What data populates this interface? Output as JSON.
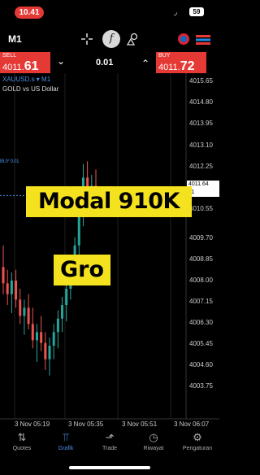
{
  "status_bar": {
    "time": "10.41",
    "battery": "59",
    "colors": {
      "time_pill": "#e53935"
    }
  },
  "toolbar": {
    "timeframe": "M1",
    "icons": [
      "crosshair-icon",
      "indicator-f-icon",
      "objects-icon",
      "history-clock-icon",
      "trade-stack-icon"
    ]
  },
  "trade_bar": {
    "sell_label": "SELL",
    "sell_price_small": "4011.",
    "sell_price_big": "61",
    "lot": "0.01",
    "buy_label": "BUY",
    "buy_price_small": "4011.",
    "buy_price_big": "72",
    "colors": {
      "sell": "#e53935",
      "buy": "#e53935"
    }
  },
  "chart": {
    "symbol": "XAUUSD.s ▾ M1",
    "description": "GOLD vs US Dollar",
    "price_tag_top": "4011.64",
    "price_tag_bottom": "11",
    "left_label": "BUY 0.01",
    "captions": {
      "line1": "Modal 910K",
      "line2": "Gro"
    },
    "colors": {
      "up": "#26a69a",
      "down": "#ef5350",
      "grid": "#1f1f1f",
      "caption_bg": "#f5e21e"
    }
  },
  "chart_data": {
    "type": "candlestick",
    "y_axis_labels": [
      "4015.65",
      "4014.80",
      "4013.95",
      "4013.10",
      "4012.25",
      "4011.40",
      "4010.55",
      "4009.70",
      "4008.85",
      "4008.00",
      "4007.15",
      "4006.30",
      "4005.45",
      "4004.60",
      "4003.75"
    ],
    "x_axis_labels": [
      "3 Nov 05:19",
      "3 Nov 05:35",
      "3 Nov 05:51",
      "3 Nov 06:07"
    ],
    "ylim": [
      3003.4,
      4016.0
    ],
    "candles": [
      {
        "o": 4009.0,
        "h": 4009.8,
        "l": 4008.0,
        "c": 4008.4
      },
      {
        "o": 4008.4,
        "h": 4008.9,
        "l": 4007.6,
        "c": 4008.0
      },
      {
        "o": 4008.0,
        "h": 4008.8,
        "l": 4007.3,
        "c": 4008.5
      },
      {
        "o": 4008.5,
        "h": 4008.9,
        "l": 4007.5,
        "c": 4007.8
      },
      {
        "o": 4007.8,
        "h": 4008.2,
        "l": 4006.9,
        "c": 4007.2
      },
      {
        "o": 4007.2,
        "h": 4007.8,
        "l": 4006.5,
        "c": 4007.5
      },
      {
        "o": 4007.5,
        "h": 4008.0,
        "l": 4006.7,
        "c": 4006.9
      },
      {
        "o": 4006.9,
        "h": 4007.5,
        "l": 4006.0,
        "c": 4006.3
      },
      {
        "o": 4006.3,
        "h": 4006.9,
        "l": 4005.5,
        "c": 4006.6
      },
      {
        "o": 4006.6,
        "h": 4007.2,
        "l": 4005.9,
        "c": 4006.2
      },
      {
        "o": 4006.2,
        "h": 4006.6,
        "l": 4005.2,
        "c": 4005.6
      },
      {
        "o": 4005.6,
        "h": 4006.4,
        "l": 4005.0,
        "c": 4006.1
      },
      {
        "o": 4006.1,
        "h": 4006.9,
        "l": 4005.6,
        "c": 4006.6
      },
      {
        "o": 4006.6,
        "h": 4007.4,
        "l": 4006.0,
        "c": 4007.1
      },
      {
        "o": 4007.1,
        "h": 4007.9,
        "l": 4006.6,
        "c": 4007.6
      },
      {
        "o": 4007.6,
        "h": 4008.5,
        "l": 4007.0,
        "c": 4008.2
      },
      {
        "o": 4008.2,
        "h": 4009.2,
        "l": 4007.8,
        "c": 4009.0
      },
      {
        "o": 4009.0,
        "h": 4010.1,
        "l": 4008.5,
        "c": 4009.8
      },
      {
        "o": 4009.8,
        "h": 4011.3,
        "l": 4009.4,
        "c": 4011.0
      },
      {
        "o": 4011.0,
        "h": 4012.8,
        "l": 4010.5,
        "c": 4012.3
      },
      {
        "o": 4012.3,
        "h": 4012.9,
        "l": 4011.0,
        "c": 4011.5
      },
      {
        "o": 4011.5,
        "h": 4012.4,
        "l": 4010.9,
        "c": 4012.0
      },
      {
        "o": 4012.0,
        "h": 4012.6,
        "l": 4011.0,
        "c": 4011.6
      }
    ]
  },
  "nav": {
    "items": [
      {
        "label": "Quotes",
        "icon": "quotes-icon"
      },
      {
        "label": "Grafik",
        "icon": "chart-icon"
      },
      {
        "label": "Trade",
        "icon": "trade-icon"
      },
      {
        "label": "Riwayat",
        "icon": "history-icon"
      },
      {
        "label": "Pengaturan",
        "icon": "settings-icon"
      }
    ],
    "active_index": 1
  }
}
